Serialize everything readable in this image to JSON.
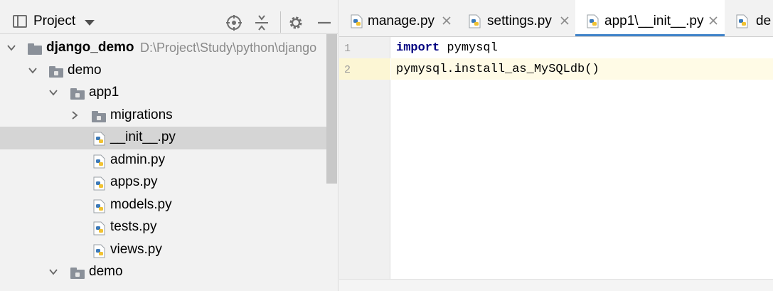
{
  "project_panel": {
    "title": "Project",
    "tree": [
      {
        "label": "django_demo",
        "path": "D:\\Project\\Study\\python\\django",
        "kind": "root",
        "expanded": true
      },
      {
        "label": "demo",
        "kind": "folder",
        "expanded": true
      },
      {
        "label": "app1",
        "kind": "folder",
        "expanded": true
      },
      {
        "label": "migrations",
        "kind": "folder",
        "expanded": false
      },
      {
        "label": "__init__.py",
        "kind": "python-file",
        "selected": true
      },
      {
        "label": "admin.py",
        "kind": "python-file"
      },
      {
        "label": "apps.py",
        "kind": "python-file"
      },
      {
        "label": "models.py",
        "kind": "python-file"
      },
      {
        "label": "tests.py",
        "kind": "python-file"
      },
      {
        "label": "views.py",
        "kind": "python-file"
      },
      {
        "label": "demo",
        "kind": "folder",
        "expanded": true
      }
    ]
  },
  "editor": {
    "tabs": [
      {
        "label": "manage.py",
        "active": false
      },
      {
        "label": "settings.py",
        "active": false
      },
      {
        "label": "app1\\__init__.py",
        "active": true
      },
      {
        "label": "de",
        "active": false
      }
    ],
    "lines": [
      {
        "number": "1",
        "keyword": "import",
        "rest": " pymysql"
      },
      {
        "number": "2",
        "keyword": "",
        "rest": "pymysql.install_as_MySQLdb()"
      }
    ],
    "current_line": 2
  },
  "colors": {
    "accent": "#4083c9",
    "keyword": "#000080",
    "selection": "#d5d5d5",
    "current_line": "#fffbe6"
  }
}
